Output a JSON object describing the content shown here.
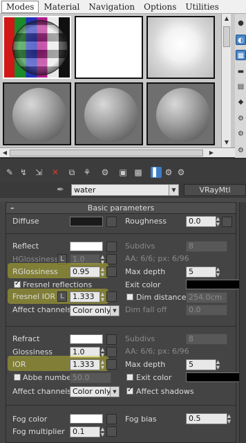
{
  "menubar": {
    "items": [
      "Modes",
      "Material",
      "Navigation",
      "Options",
      "Utilities"
    ],
    "active": "Modes"
  },
  "material": {
    "name": "water",
    "type": "VRayMtl"
  },
  "rollout": {
    "title": "Basic parameters",
    "collapse_symbol": "–"
  },
  "diffuse": {
    "label": "Diffuse",
    "color": "#1a1a1a",
    "roughness_label": "Roughness",
    "roughness_value": "0.0"
  },
  "reflect": {
    "label": "Reflect",
    "color": "#ffffff",
    "hglossiness_label": "HGlossiness",
    "hglossiness_value": "1.0",
    "rglossiness_label": "RGlossiness",
    "rglossiness_value": "0.95",
    "fresnel_label": "Fresnel reflections",
    "fresnel_checked": true,
    "fresnel_ior_label": "Fresnel IOR",
    "fresnel_ior_value": "1.333",
    "lock_label": "L",
    "affect_channels_label": "Affect channels",
    "affect_channels_value": "Color only",
    "subdivs_label": "Subdivs",
    "subdivs_value": "8",
    "aa_label": "AA: 6/6; px: 6/96",
    "max_depth_label": "Max depth",
    "max_depth_value": "5",
    "exit_color_label": "Exit color",
    "exit_color": "#000000",
    "dim_distance_label": "Dim distance",
    "dim_distance_value": "254.0cm",
    "dim_falloff_label": "Dim fall off",
    "dim_falloff_value": "0.0"
  },
  "refract": {
    "label": "Refract",
    "color": "#ffffff",
    "glossiness_label": "Glossiness",
    "glossiness_value": "1.0",
    "ior_label": "IOR",
    "ior_value": "1.333",
    "abbe_label": "Abbe number",
    "abbe_value": "50.0",
    "affect_channels_label": "Affect channels",
    "affect_channels_value": "Color only",
    "subdivs_label": "Subdivs",
    "subdivs_value": "8",
    "aa_label": "AA: 6/6; px: 6/96",
    "max_depth_label": "Max depth",
    "max_depth_value": "5",
    "exit_color_label": "Exit color",
    "exit_color": "#000000",
    "affect_shadows_label": "Affect shadows",
    "affect_shadows_checked": true
  },
  "fog": {
    "color_label": "Fog color",
    "color": "#ffffff",
    "bias_label": "Fog bias",
    "bias_value": "0.5",
    "multiplier_label": "Fog multiplier",
    "multiplier_value": "0.1"
  },
  "colors": {
    "highlight": "#cdc828",
    "selected_tool": "#3c7cc8"
  }
}
